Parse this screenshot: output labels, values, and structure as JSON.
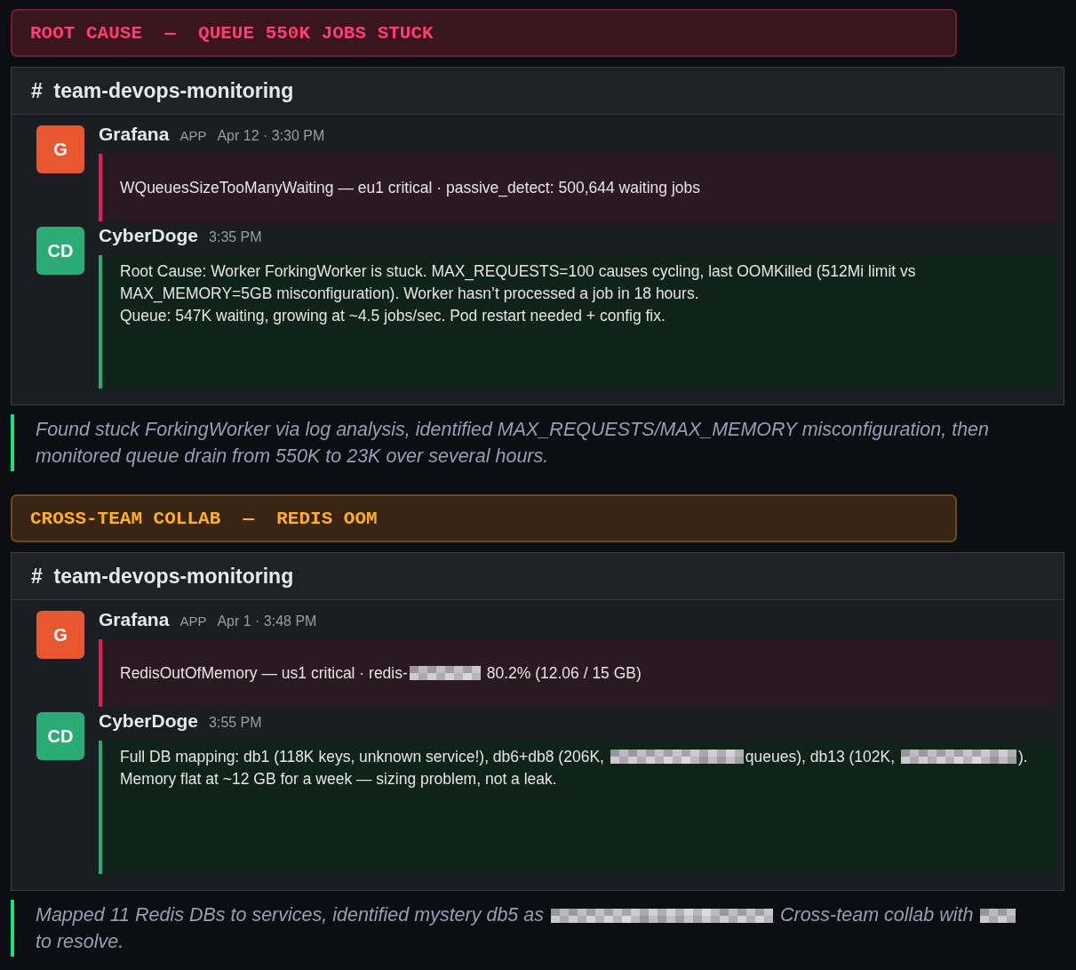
{
  "sections": [
    {
      "banner": {
        "text": "ROOT CAUSE  —  QUEUE 550K JOBS STUCK",
        "color": "#ff3d6e"
      },
      "channel": {
        "title": "#  team-devops-monitoring",
        "messages": [
          {
            "kind": "alert",
            "avatar": "G",
            "color": "#e8572f",
            "author": "Grafana",
            "badge": "APP",
            "time": "Apr 12 · 3:30 PM",
            "paragraphs": [
              [
                {
                  "kind": "text",
                  "text": "WQueuesSizeTooManyWaiting — eu1 critical · passive_detect: 500,644 waiting jobs"
                }
              ]
            ]
          },
          {
            "kind": "reply",
            "avatar": "CD",
            "color": "#2bab75",
            "author": "CyberDoge",
            "time": "3:35 PM",
            "paragraphs": [
              [
                {
                  "kind": "text",
                  "text": "Root Cause: Worker ForkingWorker is stuck. MAX_REQUESTS=100 causes cycling, last OOMKilled (512Mi limit vs MAX_MEMORY=5GB misconfiguration). Worker hasn’t processed a job in 18 hours."
                }
              ],
              [
                {
                  "kind": "text",
                  "text": "Queue: 547K waiting, growing at ~4.5 jobs/sec. Pod restart needed + config fix."
                }
              ]
            ]
          }
        ]
      },
      "caption": [
        {
          "kind": "text",
          "text": "Found stuck ForkingWorker via log analysis, identified MAX_REQUESTS/MAX_MEMORY misconfiguration, then monitored queue drain from 550K to 23K over several hours."
        }
      ]
    },
    {
      "banner": {
        "text": "CROSS-TEAM COLLAB  —  REDIS OOM",
        "color": "#ffb020"
      },
      "channel": {
        "title": "#  team-devops-monitoring",
        "messages": [
          {
            "kind": "alert",
            "avatar": "G",
            "color": "#e8572f",
            "author": "Grafana",
            "badge": "APP",
            "time": "Apr 1 · 3:48 PM",
            "paragraphs": [
              [
                {
                  "kind": "text",
                  "text": "RedisOutOfMemory — us1 critical · redis-"
                },
                {
                  "kind": "redacted"
                },
                {
                  "kind": "text",
                  "text": " 80.2% (12.06 / 15 GB)"
                }
              ]
            ]
          },
          {
            "kind": "reply",
            "avatar": "CD",
            "color": "#2bab75",
            "author": "CyberDoge",
            "time": "3:55 PM",
            "paragraphs": [
              [
                {
                  "kind": "text",
                  "text": "Full DB mapping: db1 (118K keys, unknown service!), db6+db8 (206K, "
                },
                {
                  "kind": "redacted"
                },
                {
                  "kind": "text",
                  "text": "queues), db13 (102K, "
                },
                {
                  "kind": "redacted"
                },
                {
                  "kind": "text",
                  "text": "). Memory flat at ~12 GB for a week — sizing problem, not a leak."
                }
              ]
            ]
          }
        ]
      },
      "caption": [
        {
          "kind": "text",
          "text": "Mapped 11 Redis DBs to services, identified mystery db5 as "
        },
        {
          "kind": "redacted"
        },
        {
          "kind": "text",
          "text": " Cross-team collab with "
        },
        {
          "kind": "redacted"
        },
        {
          "kind": "text",
          "text": " to resolve."
        }
      ]
    }
  ]
}
